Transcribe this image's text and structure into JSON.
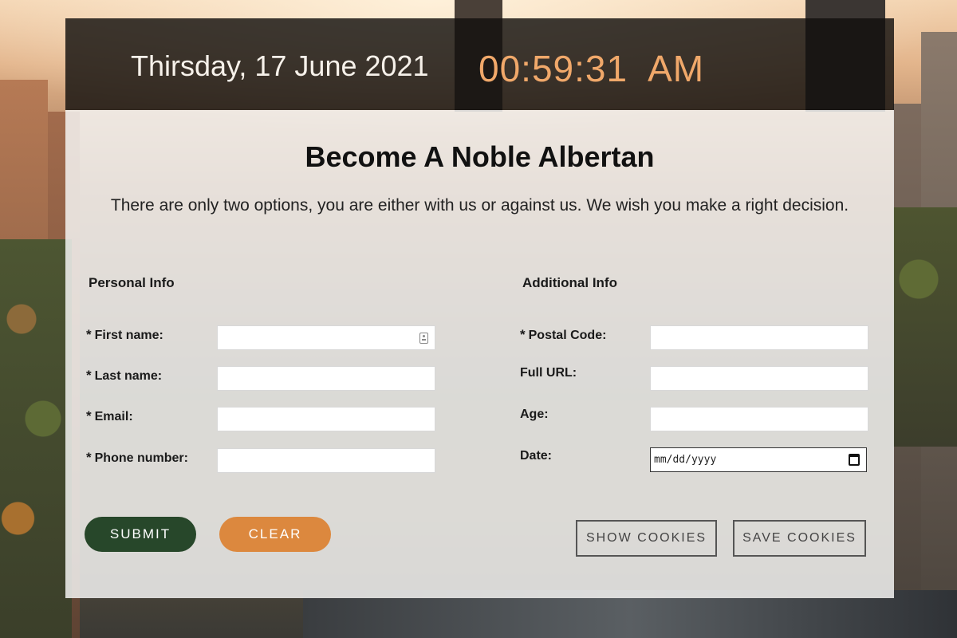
{
  "header": {
    "date": "Thirsday, 17 June 2021",
    "time": "00:59:31  AM"
  },
  "form": {
    "title": "Become A Noble Albertan",
    "subtitle": "There are only two options, you are either with us or against us. We wish you make a right decision.",
    "personal_section": "Personal Info",
    "additional_section": "Additional Info",
    "required_mark": "*",
    "personal_fields": {
      "first_name": "First name:",
      "last_name": "Last name:",
      "email": "Email:",
      "phone": "Phone number:"
    },
    "additional_fields": {
      "postal_code": "Postal Code:",
      "full_url": "Full URL:",
      "age": "Age:",
      "date": "Date:"
    },
    "date_placeholder": "mm/dd/yyyy",
    "buttons": {
      "submit": "SUBMIT",
      "clear": "CLEAR",
      "show_cookies": "SHOW COOKIES",
      "save_cookies": "SAVE COOKIES"
    }
  },
  "colors": {
    "time_accent": "#f0a86a",
    "submit_bg": "#27472a",
    "clear_bg": "#dc883e"
  },
  "icons": {
    "contact_card": "contact-card-icon",
    "calendar": "calendar-icon"
  }
}
